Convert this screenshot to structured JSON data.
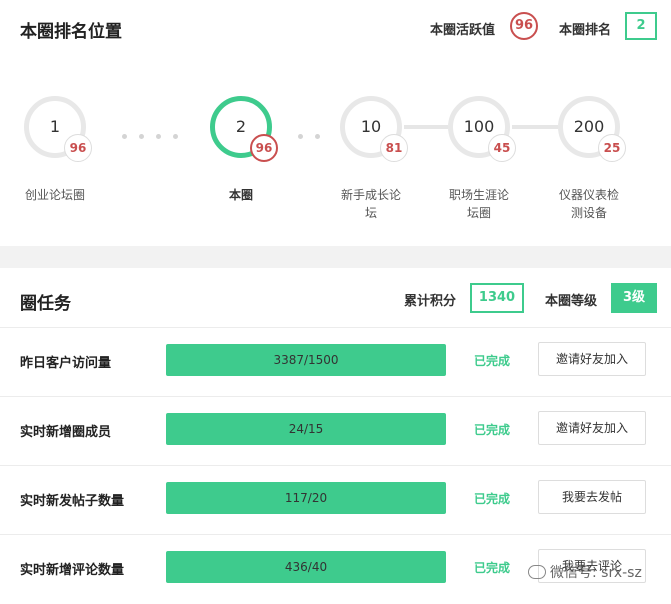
{
  "rank": {
    "title": "本圈排名位置",
    "activity_label": "本圈活跃值",
    "activity_value": "96",
    "rank_label": "本圈排名",
    "rank_value": "2",
    "nodes": [
      {
        "rank": "1",
        "score": "96",
        "name": "创业论坛圈"
      },
      {
        "rank": "2",
        "score": "96",
        "name": "本圈"
      },
      {
        "rank": "10",
        "score": "81",
        "name": "新手成长论坛"
      },
      {
        "rank": "100",
        "score": "45",
        "name": "职场生涯论坛圈"
      },
      {
        "rank": "200",
        "score": "25",
        "name": "仪器仪表检测设备"
      }
    ]
  },
  "tasks": {
    "title": "圈任务",
    "points_label": "累计积分",
    "points_value": "1340",
    "level_label": "本圈等级",
    "level_value": "3级",
    "rows": [
      {
        "label": "昨日客户访问量",
        "progress": "3387/1500",
        "status": "已完成",
        "action": "邀请好友加入"
      },
      {
        "label": "实时新增圈成员",
        "progress": "24/15",
        "status": "已完成",
        "action": "邀请好友加入"
      },
      {
        "label": "实时新发帖子数量",
        "progress": "117/20",
        "status": "已完成",
        "action": "我要去发帖"
      },
      {
        "label": "实时新增评论数量",
        "progress": "436/40",
        "status": "已完成",
        "action": "我要去评论"
      }
    ]
  },
  "watermark": "微信号: srx-sz",
  "colors": {
    "accent": "#3ecb8d",
    "score": "#c94f4f"
  }
}
